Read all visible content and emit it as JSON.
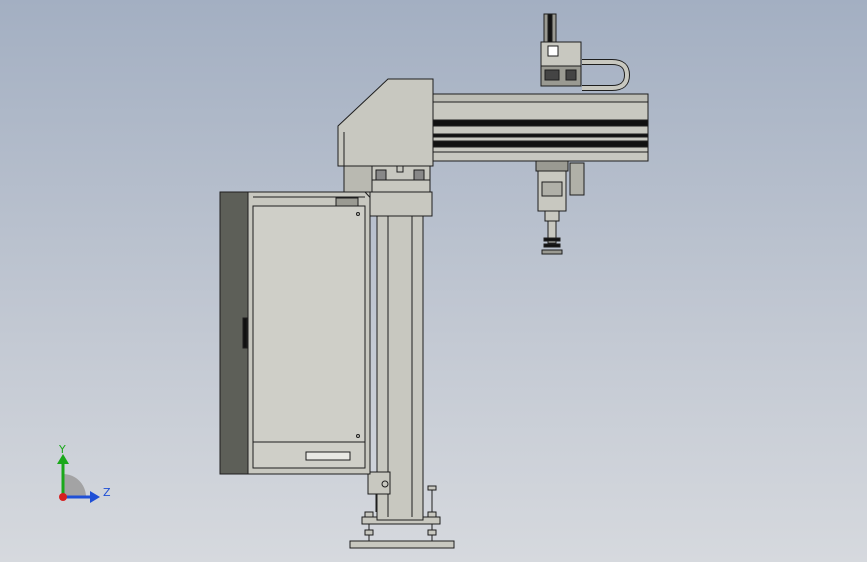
{
  "viewport": {
    "background_top": "#a3afc2",
    "background_bottom": "#d6d9de"
  },
  "triad": {
    "y_label": "Y",
    "z_label": "Z",
    "y_color": "#1aa81a",
    "z_color": "#1f4fd6",
    "x_color": "#d62020"
  },
  "model": {
    "body_color": "#c8c8c0",
    "shadow_color": "#5d5f58",
    "line_color": "#1e1e1e",
    "dark_band_color": "#111111"
  }
}
